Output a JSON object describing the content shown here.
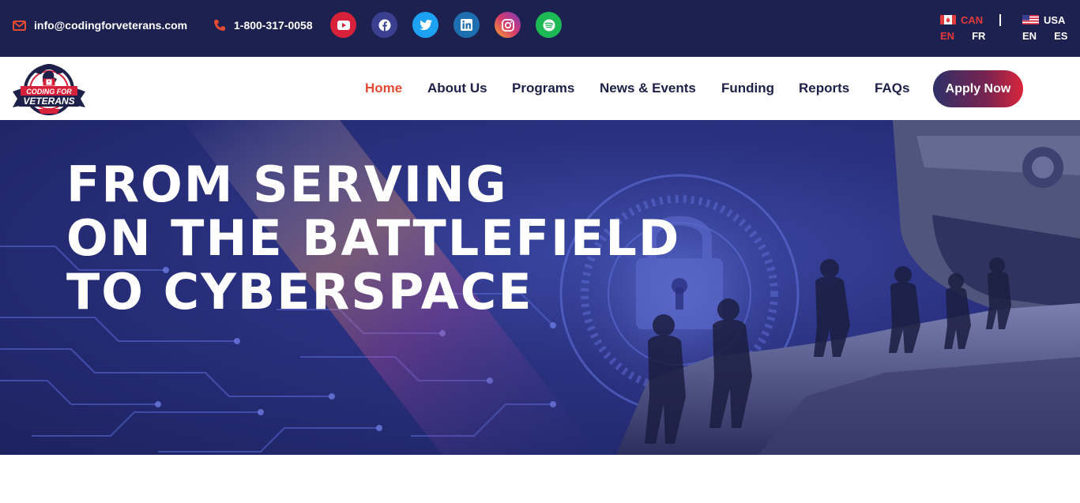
{
  "topbar": {
    "email": "info@codingforveterans.com",
    "phone": "1-800-317-0058",
    "social": [
      {
        "name": "youtube-icon",
        "color": "#d7203a"
      },
      {
        "name": "facebook-icon",
        "color": "#3b3f8f"
      },
      {
        "name": "twitter-icon",
        "color": "#1da1f2"
      },
      {
        "name": "linkedin-icon",
        "color": "#1d6fb0"
      },
      {
        "name": "instagram-icon",
        "color": "#d63a6e"
      },
      {
        "name": "spotify-icon",
        "color": "#1db954"
      }
    ],
    "regions": {
      "can": {
        "label": "CAN",
        "langs": [
          "EN",
          "FR"
        ],
        "active": "EN"
      },
      "usa": {
        "label": "USA",
        "langs": [
          "EN",
          "ES"
        ]
      }
    }
  },
  "nav": {
    "logo_text": "CODING FOR VETERANS",
    "items": [
      "Home",
      "About Us",
      "Programs",
      "News & Events",
      "Funding",
      "Reports",
      "FAQs"
    ],
    "active": "Home",
    "cta": "Apply Now"
  },
  "hero": {
    "lines": [
      "FROM SERVING",
      "ON THE BATTLEFIELD",
      "TO CYBERSPACE"
    ]
  },
  "colors": {
    "topbar_bg": "#1c2150",
    "accent_red": "#e34a33",
    "nav_text": "#1d2048",
    "hero_bg": "#2a3180"
  }
}
